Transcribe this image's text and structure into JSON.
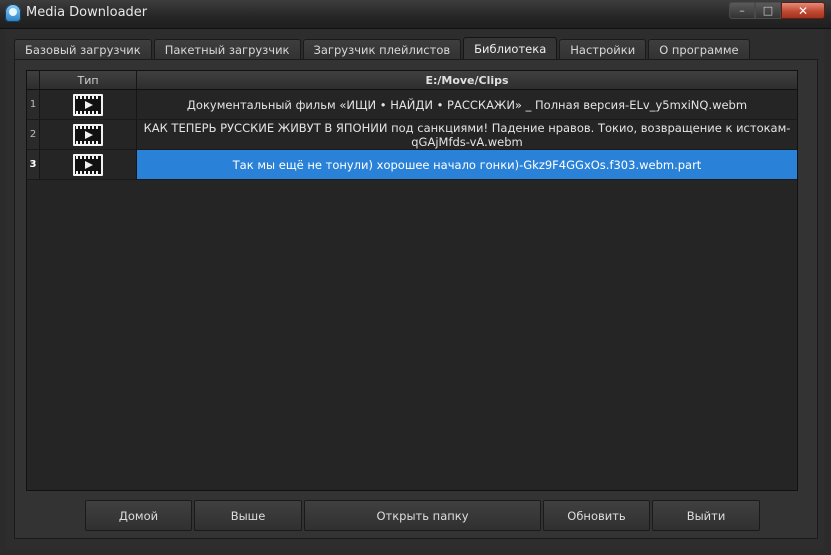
{
  "window": {
    "title": "Media Downloader",
    "controls": {
      "minimize": "–",
      "maximize": "□",
      "close": "✕"
    }
  },
  "tabs": [
    {
      "label": "Базовый загрузчик",
      "active": false
    },
    {
      "label": "Пакетный загрузчик",
      "active": false
    },
    {
      "label": "Загрузчик плейлистов",
      "active": false
    },
    {
      "label": "Библиотека",
      "active": true
    },
    {
      "label": "Настройки",
      "active": false
    },
    {
      "label": "О программе",
      "active": false
    }
  ],
  "library": {
    "columns": {
      "type": "Тип",
      "path": "E:/Move/Clips"
    },
    "rows": [
      {
        "num": "1",
        "type_icon": "video-file-icon",
        "name": "Документальный фильм «ИЩИ • НАЙДИ • РАССКАЖИ» _ Полная версия-ELv_y5mxiNQ.webm",
        "selected": false
      },
      {
        "num": "2",
        "type_icon": "video-file-icon",
        "name": "КАК ТЕПЕРЬ РУССКИЕ ЖИВУТ В ЯПОНИИ под санкциями! Падение нравов. Токио, возвращение к истокам-qGAjMfds-vA.webm",
        "selected": false
      },
      {
        "num": "3",
        "type_icon": "video-file-icon",
        "name": "Так мы ещё не тонули) хорошее начало гонки)-Gkz9F4GGxOs.f303.webm.part",
        "selected": true
      }
    ]
  },
  "buttons": {
    "home": "Домой",
    "up": "Выше",
    "open_folder": "Открыть папку",
    "refresh": "Обновить",
    "exit": "Выйти"
  },
  "colors": {
    "selection": "#2a82d8",
    "background": "#2b2b2b",
    "close_button": "#c14a33"
  }
}
